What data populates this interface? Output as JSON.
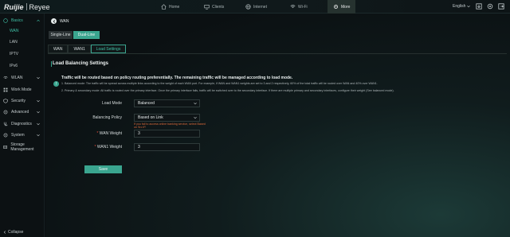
{
  "brand": {
    "name1": "Ruijie",
    "name2": "Reyee"
  },
  "topnav": {
    "home": "Home",
    "clients": "Clients",
    "internet": "Internet",
    "wifi": "Wi-Fi",
    "more": "More",
    "language": "English"
  },
  "sidebar": {
    "basics": "Basics",
    "wan": "WAN",
    "lan": "LAN",
    "iptv": "IPTV",
    "ipv6": "IPv6",
    "wlan": "WLAN",
    "work_mode": "Work Mode",
    "security": "Security",
    "advanced": "Advanced",
    "diagnostics": "Diagnostics",
    "system": "System",
    "storage": "Storage Management",
    "collapse": "Collapse"
  },
  "page": {
    "title": "WAN",
    "seg_single": "Single-Line",
    "seg_dual": "Dual-Line",
    "tabs": [
      "WAN",
      "WAN1",
      "Load Settings"
    ],
    "section_title": "Load Balancing Settings",
    "tip_title": "Traffic will be routed based on policy routing preferentially. The remaining traffic will be managed according to load mode.",
    "tip_line1": "1. Balanced mode: The traffic will be spread across multiple links according to the weight of each WAN port. For example, if WAN and WAN1 weights are set to 3 and 2 respectively, 60% of the total traffic will be routed over WAN and 40% over WAN1.",
    "tip_line2": "2. Primary & secondary mode: All traffic is routed over the primary interface. Once the primary interface fails, traffic will be switched over to the secondary interface. If there are multiple primary and secondary interfaces, configure their weight (See balanced mode).",
    "load_mode_label": "Load Mode",
    "load_mode_value": "Balanced",
    "balancing_policy_label": "Balancing Policy",
    "balancing_policy_value": "Based on Link",
    "warning": "If you fail to access online banking service, select Based on Src IP.",
    "wan_weight_label": "WAN Weight",
    "wan_weight_value": "3",
    "wan1_weight_label": "WAN1 Weight",
    "wan1_weight_value": "3",
    "required_mark": "*",
    "submit": "Save"
  },
  "colors": {
    "accent": "#3aa58f",
    "warning": "#e06b3b",
    "background": "#0b0f12"
  }
}
